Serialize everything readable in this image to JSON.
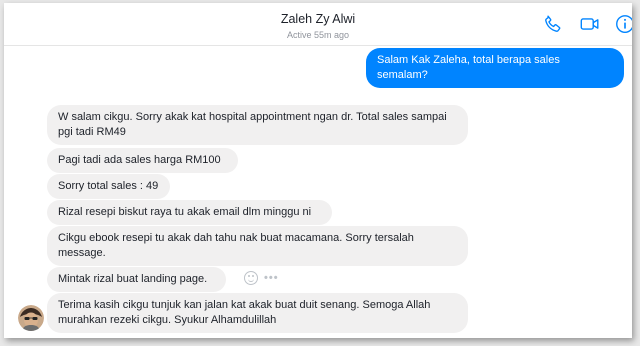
{
  "header": {
    "contact_name": "Zaleh Zy Alwi",
    "status": "Active 55m ago",
    "icons": [
      "phone-icon",
      "video-camera-icon",
      "info-icon"
    ],
    "accent_color": "#0084ff"
  },
  "messages": {
    "outgoing": [
      "Salam Kak Zaleha, total berapa sales semalam?"
    ],
    "incoming": [
      "W salam cikgu.  Sorry akak kat hospital appointment ngan dr.  Total sales sampai pgi tadi RM49",
      "Pagi tadi ada sales harga RM100",
      "Sorry total sales : 49",
      "Rizal resepi biskut raya tu akak email dlm minggu ni",
      "Cikgu ebook resepi tu akak dah tahu nak buat macamana.  Sorry tersalah message.",
      "Mintak rizal buat landing page.",
      "Terima kasih cikgu tunjuk kan jalan kat akak buat duit senang.  Semoga Allah murahkan rezeki cikgu.  Syukur Alhamdulillah"
    ]
  },
  "message_actions": {
    "icons": [
      "emoji-reaction-icon",
      "more-options-icon"
    ],
    "more_label": "•••"
  },
  "colors": {
    "incoming_bubble": "#f1f0f0",
    "outgoing_bubble": "#0084ff"
  }
}
